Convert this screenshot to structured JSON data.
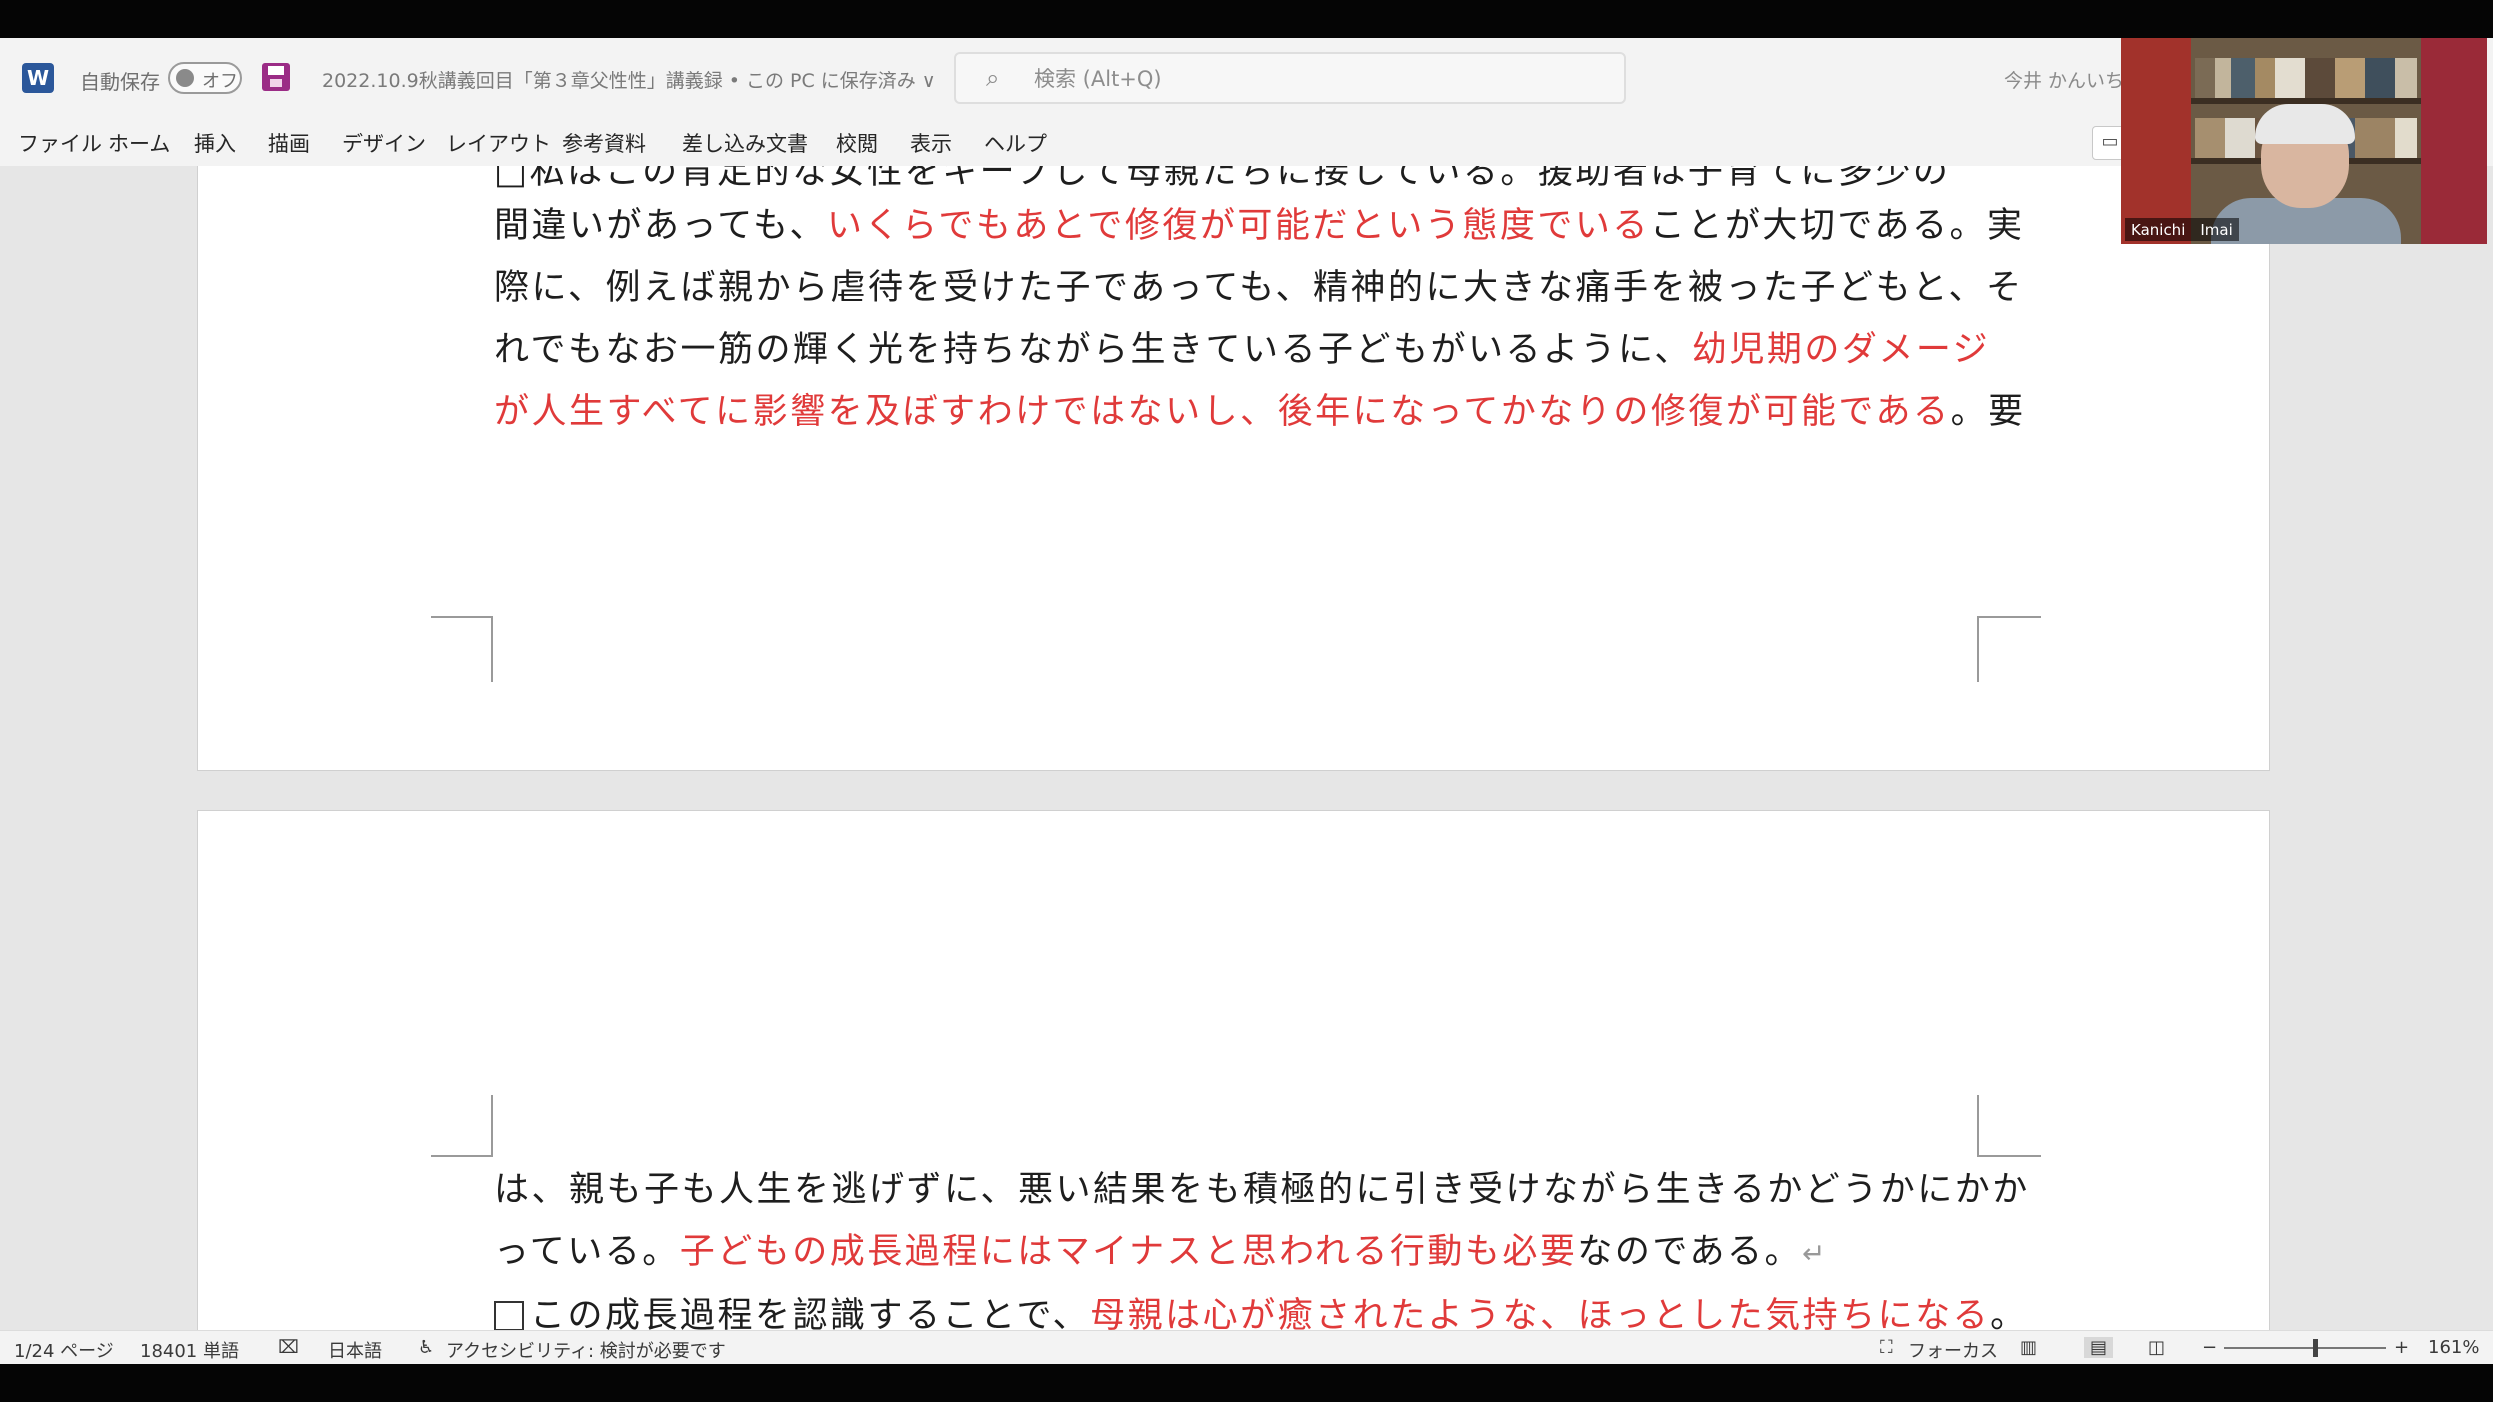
{
  "titlebar": {
    "app_icon": "word-icon",
    "autosave_label": "自動保存",
    "autosave_state": "オフ",
    "document_title": "2022.10.9秋講義回目「第３章父性性」講義録 • この PC に保存済み",
    "title_dropdown_glyph": "∨",
    "search_placeholder": "検索 (Alt+Q)",
    "user_name": "今井 かんいち"
  },
  "ribbon": {
    "tabs": [
      "ファイル",
      "ホーム",
      "挿入",
      "描画",
      "デザイン",
      "レイアウト",
      "参考資料",
      "差し込み文書",
      "校閲",
      "表示",
      "ヘルプ"
    ]
  },
  "video": {
    "participant_name": "Kanichi　Imai"
  },
  "document": {
    "page1_cutoff_line": "□私はこの肯定的な女性をキープして母親たちに接している。援助者は子育てに多少の",
    "page1_lines": [
      [
        {
          "text": "間違いがあっても、",
          "red": false
        },
        {
          "text": "いくらでもあとで修復が可能だという態度でいる",
          "red": true
        },
        {
          "text": "ことが大切である。実",
          "red": false
        }
      ],
      [
        {
          "text": "際に、例えば親から虐待を受けた子であっても、精神的に大きな痛手を被った子どもと、そ",
          "red": false
        }
      ],
      [
        {
          "text": "れでもなお一筋の輝く光を持ちながら生きている子どもがいるように、",
          "red": false
        },
        {
          "text": "幼児期のダメージ",
          "red": true
        }
      ],
      [
        {
          "text": "が人生すべてに影響を及ぼすわけではないし、後年になってかなりの修復が可能である",
          "red": true
        },
        {
          "text": "。要",
          "red": false
        }
      ]
    ],
    "page2_lines": [
      [
        {
          "text": "は、親も子も人生を逃げずに、悪い結果をも積極的に引き受けながら生きるかどうかにかか",
          "red": false
        }
      ],
      [
        {
          "text": "っている。",
          "red": false
        },
        {
          "text": "子どもの成長過程にはマイナスと思われる行動も必要",
          "red": true
        },
        {
          "text": "なのである。",
          "red": false
        },
        {
          "text": "↵",
          "red": false,
          "mark": true
        }
      ],
      [
        {
          "text": "この成長過程を認識することで、",
          "red": false,
          "checkbox": true
        },
        {
          "text": "母親は心が癒されたような、ほっとした気持ちになる",
          "red": true
        },
        {
          "text": "。",
          "red": false
        }
      ]
    ]
  },
  "statusbar": {
    "page": "1/24 ページ",
    "words": "18401 単語",
    "language": "日本語",
    "accessibility": "アクセシビリティ: 検討が必要です",
    "focus": "フォーカス",
    "zoom_out": "−",
    "zoom_in": "+",
    "zoom_level": "161%",
    "zoom_fraction": 0.56
  },
  "colors": {
    "red_text": "#e03a3a",
    "word_blue": "#2b579a",
    "save_purple": "#9b2c86"
  }
}
